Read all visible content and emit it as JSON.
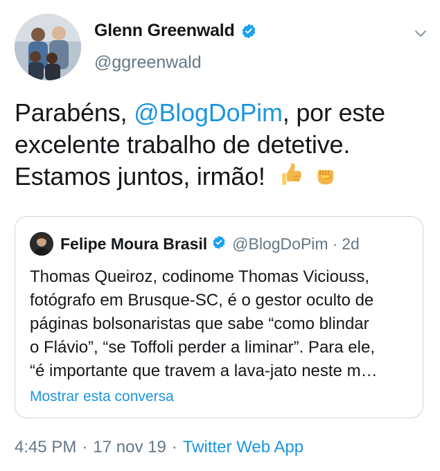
{
  "author": {
    "name": "Glenn Greenwald",
    "handle": "@ggreenwald",
    "verified": true
  },
  "tweet": {
    "text_before_mention": "Parabéns, ",
    "mention": "@BlogDoPim",
    "text_after_mention": ", por este excelente trabalho de detetive. Estamos juntos, irmão!",
    "emojis": [
      "thumbs-up",
      "raised-fist"
    ]
  },
  "quoted_tweet": {
    "author_name": "Felipe Moura Brasil",
    "verified": true,
    "handle": "@BlogDoPim",
    "dot": "·",
    "time": "2d",
    "lines": [
      "Thomas Queiroz, codinome Thomas Viciouss,",
      "fotógrafo em Brusque-SC, é o gestor oculto de",
      "páginas bolsonaristas que sabe “como blindar",
      "o Flávio”, “se Toffoli perder a liminar”. Para ele,",
      "“é importante que travem a lava-jato neste m…"
    ],
    "show_thread": "Mostrar esta conversa"
  },
  "footer": {
    "time": "4:45 PM",
    "sep1": "·",
    "date": "17 nov 19",
    "sep2": "·",
    "source": "Twitter Web App"
  },
  "colors": {
    "link": "#1b95e0",
    "secondary_text": "#657786",
    "verified": "#1da1f2"
  }
}
